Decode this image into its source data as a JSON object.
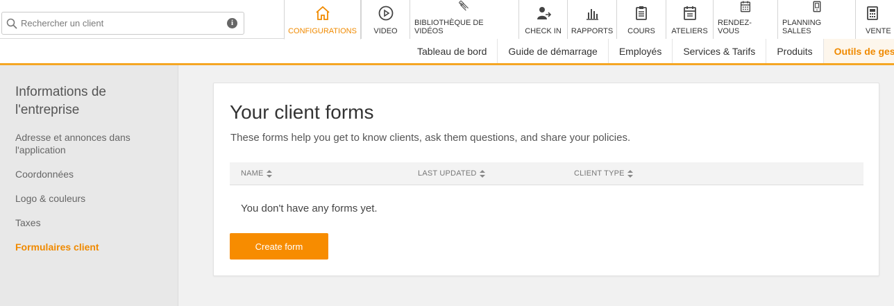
{
  "search": {
    "placeholder": "Rechercher un client",
    "info_icon": "info-icon",
    "info_glyph": "i"
  },
  "nav": [
    {
      "label": "CONFIGURATIONS",
      "icon": "home-icon",
      "active": true
    },
    {
      "label": "VIDEO",
      "icon": "play-icon"
    },
    {
      "label": "BIBLIOTHÈQUE DE VIDÉOS",
      "icon": "video-library-icon"
    },
    {
      "label": "CHECK IN",
      "icon": "checkin-icon"
    },
    {
      "label": "RAPPORTS",
      "icon": "bar-chart-icon"
    },
    {
      "label": "COURS",
      "icon": "clipboard-icon"
    },
    {
      "label": "ATELIERS",
      "icon": "calendar-icon"
    },
    {
      "label": "RENDEZ-VOUS",
      "icon": "calendar-grid-icon"
    },
    {
      "label": "PLANNING SALLES",
      "icon": "door-icon"
    },
    {
      "label": "VENTE",
      "icon": "cash-register-icon"
    }
  ],
  "subnav": [
    "Tableau de bord",
    "Guide de démarrage",
    "Employés",
    "Services & Tarifs",
    "Produits",
    "Outils de gest"
  ],
  "sidebar": {
    "title": "Informations de l'entreprise",
    "links": [
      "Adresse et annonces dans l'application",
      "Coordonnées",
      "Logo & couleurs",
      "Taxes",
      "Formulaires client"
    ]
  },
  "main": {
    "title": "Your client forms",
    "subtitle": "These forms help you get to know clients, ask them questions, and share your policies.",
    "columns": [
      "NAME",
      "LAST UPDATED",
      "CLIENT TYPE"
    ],
    "empty_text": "You don't have any forms yet.",
    "create_button": "Create form"
  },
  "colors": {
    "accent": "#f08a00",
    "button": "#f78c00",
    "underline": "#f5a623"
  }
}
